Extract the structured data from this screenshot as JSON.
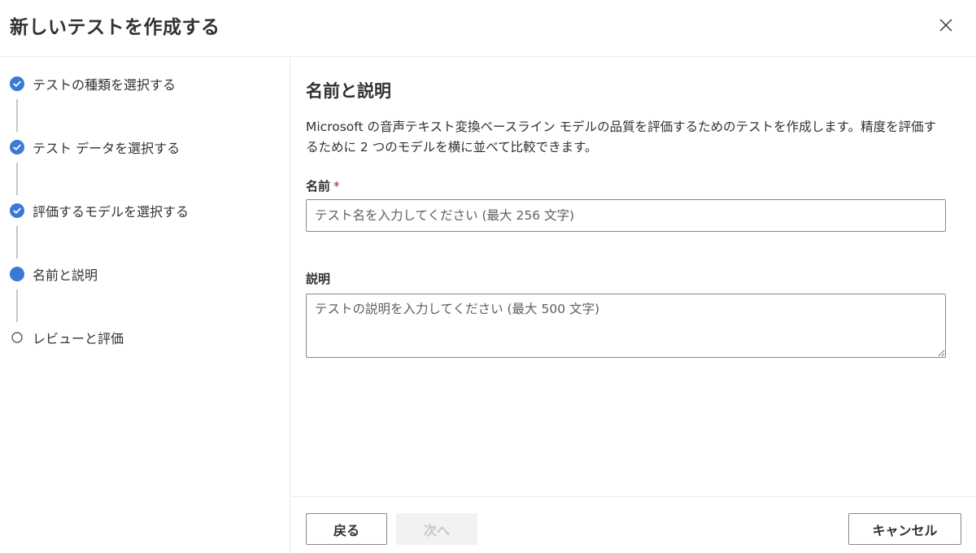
{
  "dialog": {
    "title": "新しいテストを作成する",
    "close_icon": "close-icon"
  },
  "steps": [
    {
      "label": "テストの種類を選択する",
      "state": "completed",
      "icon": "check-circle-icon"
    },
    {
      "label": "テスト データを選択する",
      "state": "completed",
      "icon": "check-circle-icon"
    },
    {
      "label": "評価するモデルを選択する",
      "state": "completed",
      "icon": "check-circle-icon"
    },
    {
      "label": "名前と説明",
      "state": "current",
      "icon": "filled-circle-icon"
    },
    {
      "label": "レビューと評価",
      "state": "pending",
      "icon": "empty-circle-icon"
    }
  ],
  "main": {
    "section_title": "名前と説明",
    "description": "Microsoft の音声テキスト変換ベースライン モデルの品質を評価するためのテストを作成します。精度を評価するために 2 つのモデルを横に並べて比較できます。",
    "name_field": {
      "label": "名前",
      "required_marker": "*",
      "value": "",
      "placeholder": "テスト名を入力してください (最大 256 文字)"
    },
    "description_field": {
      "label": "説明",
      "value": "",
      "placeholder": "テストの説明を入力してください (最大 500 文字)"
    }
  },
  "footer": {
    "back_label": "戻る",
    "next_label": "次へ",
    "next_enabled": false,
    "cancel_label": "キャンセル"
  },
  "colors": {
    "accent": "#3a7ad4",
    "required": "#a4262c",
    "disabled_bg": "#f3f2f1",
    "disabled_text": "#c8c6c4",
    "connector": "#c8c6c4"
  }
}
